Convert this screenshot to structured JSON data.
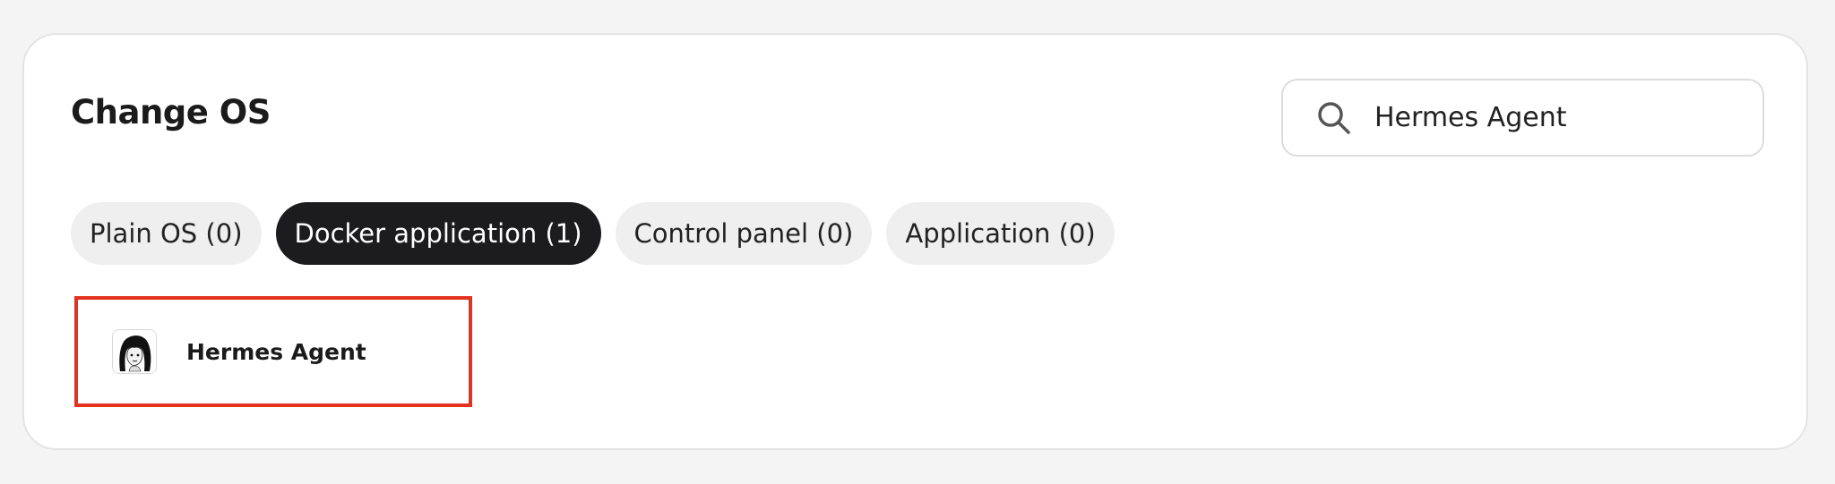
{
  "dialog": {
    "title": "Change OS"
  },
  "search": {
    "icon": "search-icon",
    "value": "Hermes Agent"
  },
  "tabs": [
    {
      "label": "Plain OS (0)",
      "active": false
    },
    {
      "label": "Docker application (1)",
      "active": true
    },
    {
      "label": "Control panel (0)",
      "active": false
    },
    {
      "label": "Application (0)",
      "active": false
    }
  ],
  "results": [
    {
      "name": "Hermes Agent",
      "icon": "hermes-agent-logo",
      "highlight_color": "#e5321f"
    }
  ]
}
